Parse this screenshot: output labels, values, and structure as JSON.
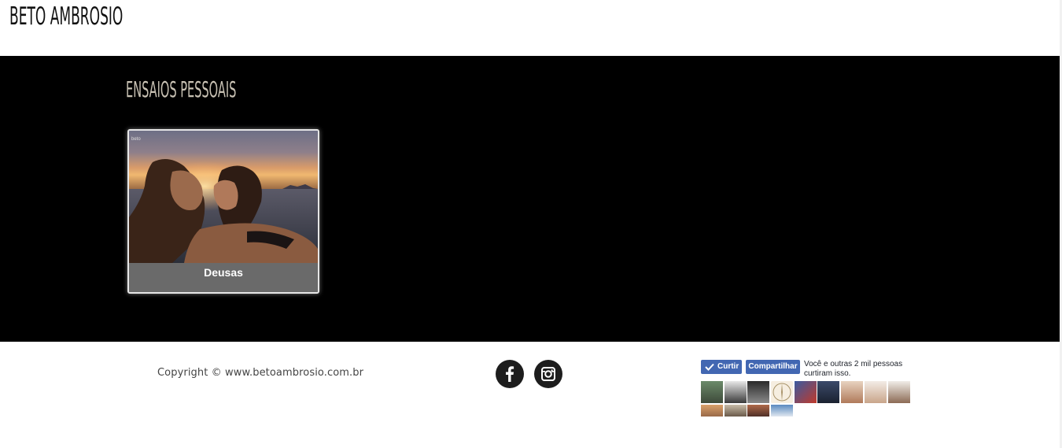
{
  "header": {
    "logo_text": "BETO AMBROSIO"
  },
  "gallery": {
    "section_title": "ENSAIOS PESSOAIS",
    "items": [
      {
        "caption": "Deusas",
        "watermark": "beto"
      }
    ]
  },
  "footer": {
    "copyright": "Copyright © www.betoambrosio.com.br",
    "social": [
      {
        "name": "facebook",
        "glyph": "f"
      },
      {
        "name": "instagram",
        "glyph": "instagram"
      }
    ],
    "fb_widget": {
      "like_label": "Curtir",
      "share_label": "Compartilhar",
      "social_text": "Você e outras 2 mil pessoas curtiram isso."
    }
  },
  "colors": {
    "dark_bg": "#000000",
    "fb_blue": "#4267b2",
    "title_color": "#c9c2b4"
  }
}
